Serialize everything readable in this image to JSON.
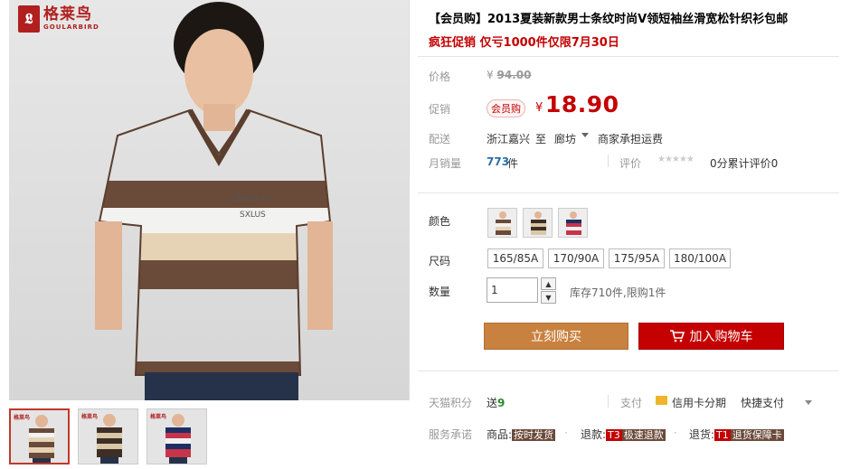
{
  "brand": {
    "logo_glyph": "𝕷",
    "name_cn": "格莱鸟",
    "name_en": "GOULARBIRD",
    "color": "#b0201f"
  },
  "product": {
    "title": "【会员购】2013夏装新款男士条纹时尚V领短袖丝滑宽松针织衫包邮",
    "promo": "疯狂促销 仅亏1000件仅限7月30日"
  },
  "price": {
    "label": "价格",
    "original_currency": "¥",
    "original": "94.00",
    "sale_label": "促销",
    "member_tag": "会员购",
    "sale_currency": "¥",
    "sale": "18.90"
  },
  "shipping": {
    "label": "配送",
    "from": "浙江嘉兴",
    "to_word": "至",
    "to": "廊坊",
    "fee": "商家承担运费"
  },
  "sales": {
    "label": "月销量",
    "count": "773",
    "unit": "件",
    "rating_label": "评价",
    "stars": "★★★★★",
    "rating_text": "0分累计评价0"
  },
  "options": {
    "color_label": "颜色",
    "size_label": "尺码",
    "sizes": [
      "165/85A",
      "170/90A",
      "175/95A",
      "180/100A"
    ],
    "qty_label": "数量",
    "qty_value": "1",
    "stock": "库存710件,限购1件"
  },
  "actions": {
    "buy_now": "立刻购买",
    "add_to_cart": "加入购物车"
  },
  "extras": {
    "points_label": "天猫积分",
    "points_prefix": "送",
    "points_value": "9",
    "pay_label": "支付",
    "credit": "信用卡分期",
    "quick_pay": "快捷支付"
  },
  "service": {
    "label": "服务承诺",
    "goods_prefix": "商品:",
    "goods_tag": "按时发货",
    "refund_prefix": "退款:",
    "refund_code": "T3",
    "refund_tag": "极速退款",
    "return_prefix": "退货:",
    "return_code": "T1",
    "return_tag": "退货保障卡"
  },
  "colors": {
    "accent_red": "#c40000",
    "buy_orange": "#c9813f",
    "link_blue": "#2b6dad"
  }
}
